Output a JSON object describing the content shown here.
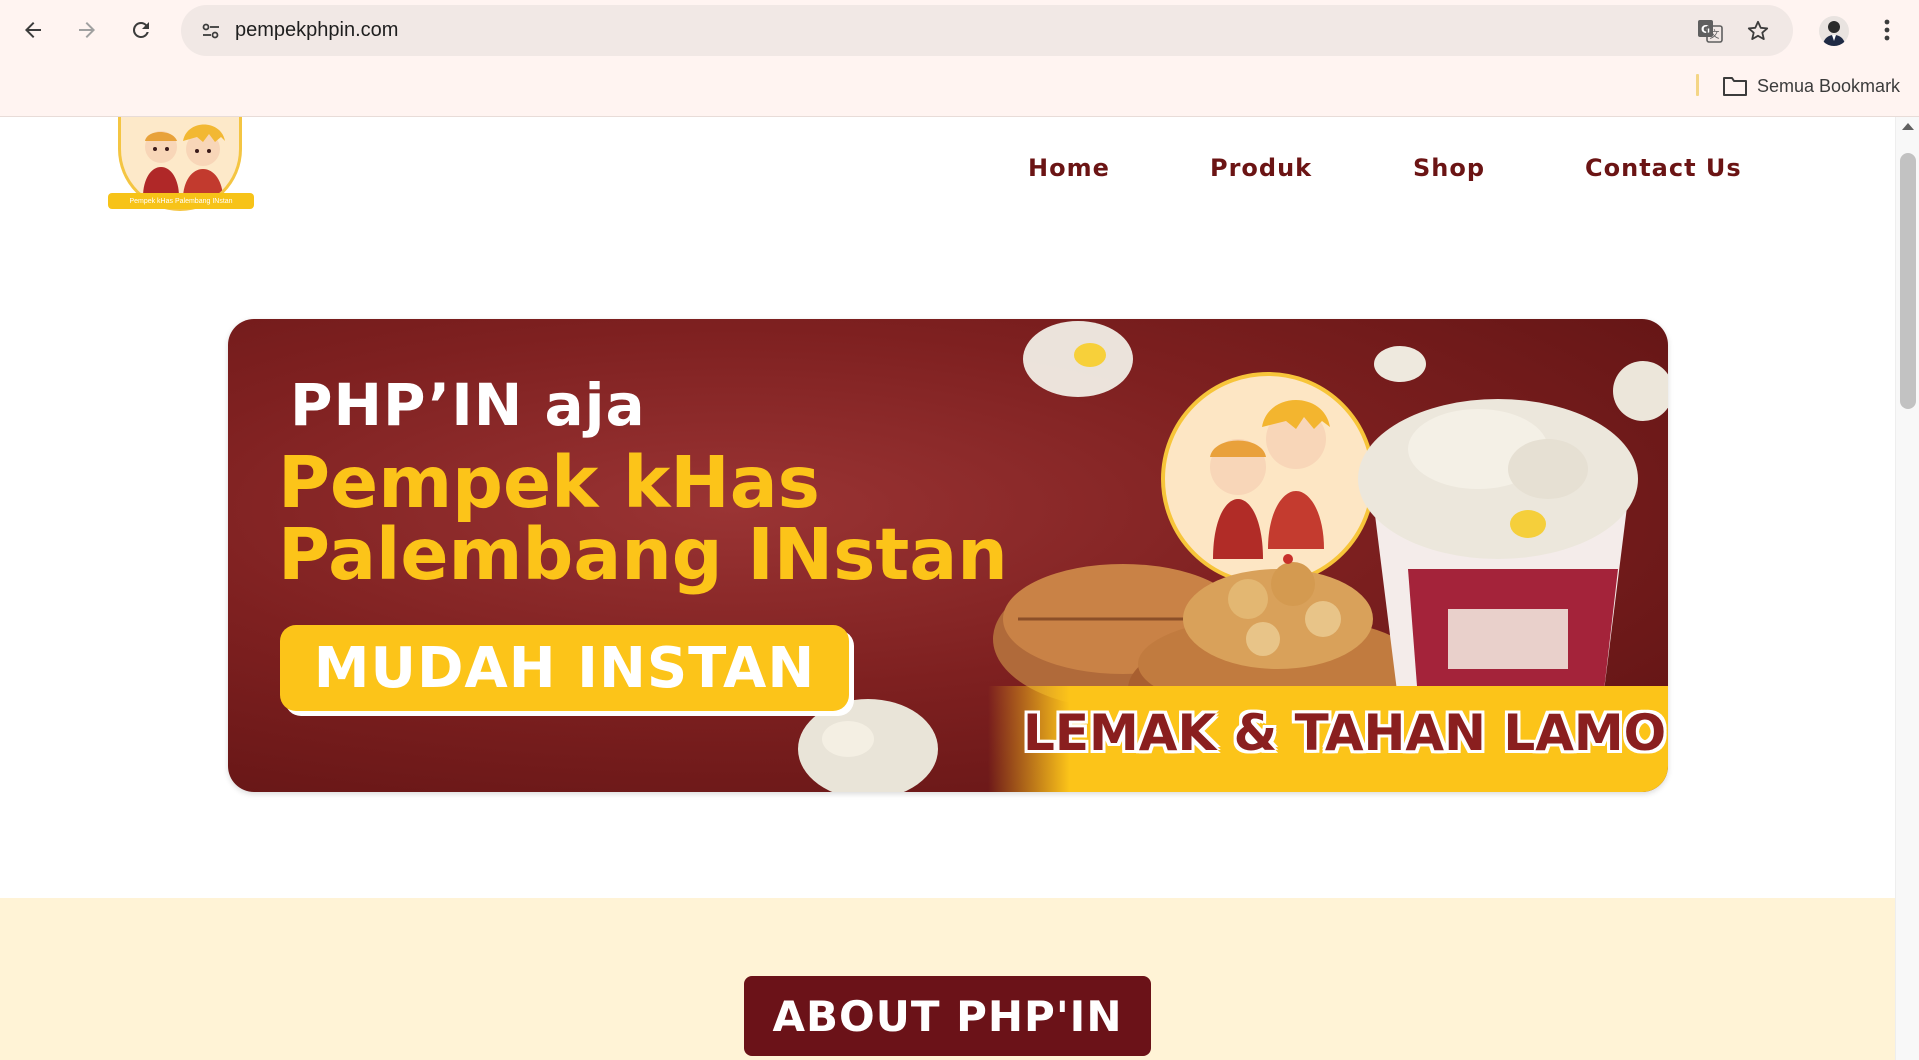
{
  "browser": {
    "url": "pempekphpin.com",
    "bookmarks_label": "Semua Bookmark"
  },
  "site": {
    "logo_text": "Pempek kHas Palembang INstan",
    "nav": {
      "home": "Home",
      "produk": "Produk",
      "shop": "Shop",
      "contact": "Contact Us"
    },
    "banner": {
      "line1": "PHP’IN aja",
      "line2": "Pempek kHas",
      "line3": "Palembang INstan",
      "cta": "MUDAH INSTAN",
      "slogan": "LEMAK & TAHAN LAMO"
    },
    "about": {
      "button": "ABOUT PHP'IN"
    }
  },
  "colors": {
    "brand_maroon": "#6b1414",
    "brand_yellow": "#fcc419",
    "about_bg": "#fff3d6"
  }
}
